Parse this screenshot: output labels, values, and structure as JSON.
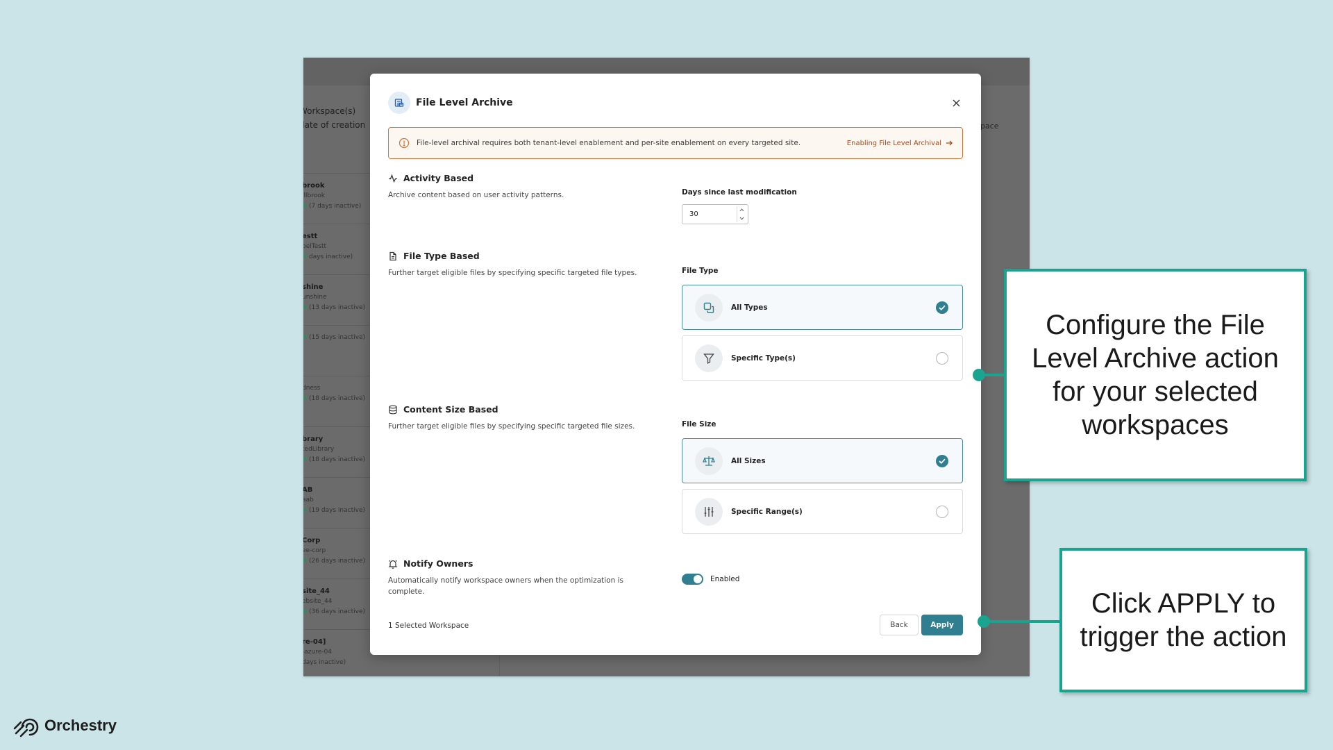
{
  "background_app": {
    "header_lines": [
      "Workspace(s)",
      "date of creation"
    ],
    "right_header": "pace",
    "rows": [
      {
        "name": "brook",
        "sub": "illbrook",
        "inactive": "(7 days inactive)"
      },
      {
        "name": "estt",
        "sub": "belTestt",
        "inactive": "days inactive)"
      },
      {
        "name": "shine",
        "sub": "unshine",
        "inactive": "(13 days inactive)"
      },
      {
        "name": "",
        "sub": "",
        "inactive": "(15 days inactive)"
      },
      {
        "name": "",
        "sub": "dness",
        "inactive": "(18 days inactive)"
      },
      {
        "name": "brary",
        "sub": "tedLibrary",
        "inactive": "(18 days inactive)"
      },
      {
        "name": "AB",
        "sub": "aab",
        "inactive": "(19 days inactive)"
      },
      {
        "name": "Corp",
        "sub": "ee-corp",
        "inactive": "(26 days inactive)"
      },
      {
        "name": "site_44",
        "sub": "ebsite_44",
        "inactive": "(36 days inactive)"
      },
      {
        "name": "re-04]",
        "sub": "-azure-04",
        "inactive": "days inactive)"
      }
    ]
  },
  "modal": {
    "title": "File Level Archive",
    "alert": {
      "text": "File-level archival requires both tenant-level enablement and per-site enablement on every targeted site.",
      "link": "Enabling File Level Archival"
    },
    "sections": {
      "activity": {
        "title": "Activity Based",
        "description": "Archive content based on user activity patterns.",
        "field_label": "Days since last modification",
        "value": "30"
      },
      "file_type": {
        "title": "File Type Based",
        "description": "Further target eligible files by specifying specific targeted file types.",
        "field_label": "File Type",
        "options": [
          {
            "label": "All Types",
            "selected": true
          },
          {
            "label": "Specific Type(s)",
            "selected": false
          }
        ]
      },
      "content_size": {
        "title": "Content Size Based",
        "description": "Further target eligible files by specifying specific targeted file sizes.",
        "field_label": "File Size",
        "options": [
          {
            "label": "All Sizes",
            "selected": true
          },
          {
            "label": "Specific Range(s)",
            "selected": false
          }
        ]
      },
      "notify": {
        "title": "Notify Owners",
        "description": "Automatically notify workspace owners when the optimization is complete.",
        "toggle_label": "Enabled",
        "enabled": true
      }
    },
    "footer": {
      "selected_count": "1 Selected Workspace",
      "back_label": "Back",
      "apply_label": "Apply"
    }
  },
  "callouts": {
    "configure": "Configure the File Level Archive action for your selected workspaces",
    "apply": "Click APPLY to trigger the action"
  },
  "brand": {
    "name": "Orchestry"
  },
  "colors": {
    "accent": "#2f7f91",
    "callout": "#1aa38e",
    "alert_border": "#d4763b",
    "page_bg": "#cbe4e7"
  }
}
